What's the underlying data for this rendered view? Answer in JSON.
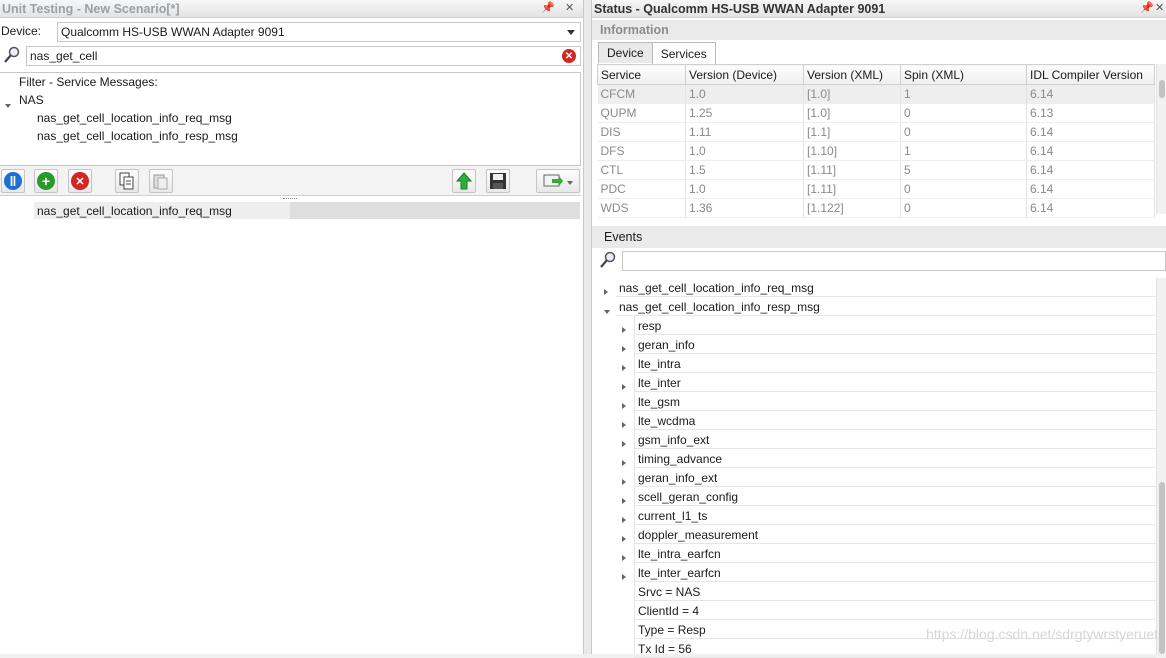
{
  "left_panel": {
    "title": "Unit Testing - New Scenario[*]",
    "pin": "―",
    "close": "✕",
    "device_label": "Device:",
    "device_value": "Qualcomm HS-USB WWAN Adapter 9091",
    "filter_value": "nas_get_cell",
    "tree": {
      "header": "Filter - Service Messages:",
      "group": "NAS",
      "items": [
        "nas_get_cell_location_info_req_msg",
        "nas_get_cell_location_info_resp_msg"
      ]
    },
    "toolbar": {
      "pause_icon": "pause-icon",
      "add_icon": "add-icon",
      "remove_icon": "remove-icon",
      "copy_icon": "copy-icon",
      "paste_icon": "paste-icon",
      "upload_icon": "upload-icon",
      "save_icon": "save-icon",
      "send_icon": "send-icon"
    },
    "queue": [
      "nas_get_cell_location_info_req_msg"
    ]
  },
  "right_panel": {
    "title": "Status - Qualcomm HS-USB WWAN Adapter 9091",
    "pin": "―",
    "close": "✕",
    "information_label": "Information",
    "tabs": [
      {
        "label": "Device"
      },
      {
        "label": "Services"
      }
    ],
    "active_tab": "Services",
    "columns": [
      "Service",
      "Version (Device)",
      "Version (XML)",
      "Spin (XML)",
      "IDL Compiler Version"
    ],
    "rows": [
      [
        "CFCM",
        "1.0",
        "[1.0]",
        "1",
        "6.14"
      ],
      [
        "QUPM",
        "1.25",
        "[1.0]",
        "0",
        "6.13"
      ],
      [
        "DIS",
        "1.11",
        "[1.1]",
        "0",
        "6.14"
      ],
      [
        "DFS",
        "1.0",
        "[1.10]",
        "1",
        "6.14"
      ],
      [
        "CTL",
        "1.5",
        "[1.11]",
        "5",
        "6.14"
      ],
      [
        "PDC",
        "1.0",
        "[1.11]",
        "0",
        "6.14"
      ],
      [
        "WDS",
        "1.36",
        "[1.122]",
        "0",
        "6.14"
      ]
    ],
    "events_label": "Events",
    "events_top": [
      {
        "label": "nas_get_cell_location_info_req_msg",
        "expanded": false
      },
      {
        "label": "nas_get_cell_location_info_resp_msg",
        "expanded": true
      }
    ],
    "events_children": [
      "resp",
      "geran_info",
      "lte_intra",
      "lte_inter",
      "lte_gsm",
      "lte_wcdma",
      "gsm_info_ext",
      "timing_advance",
      "geran_info_ext",
      "scell_geran_config",
      "current_l1_ts",
      "doppler_measurement",
      "lte_intra_earfcn",
      "lte_inter_earfcn"
    ],
    "events_fields": [
      "Srvc = NAS",
      "ClientId = 4",
      "Type = Resp",
      "Tx Id = 56"
    ]
  },
  "watermark": "https://blog.csdn.net/sdrgtywrstyeruet"
}
